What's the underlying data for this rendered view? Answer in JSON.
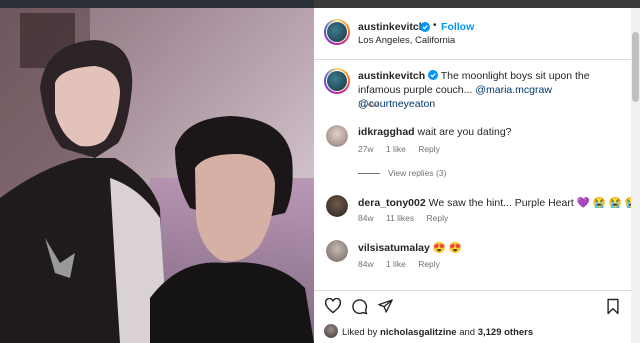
{
  "post": {
    "author": "austinkevitch",
    "follow_label": "Follow",
    "location": "Los Angeles, California",
    "caption_text": "The moonlight boys sit upon the infamous purple couch... ",
    "mentions": [
      "@maria.mcgraw",
      "@courtneyeaton"
    ],
    "age": "314w"
  },
  "comments": [
    {
      "user": "idkragghad",
      "text": "wait are you dating?",
      "age": "27w",
      "likes": "1 like",
      "reply": "Reply",
      "view_replies": "View replies (3)"
    },
    {
      "user": "dera_tony002",
      "text": "We saw the hint... Purple Heart 💜 😭 😭 😭 😭",
      "age": "84w",
      "likes": "11 likes",
      "reply": "Reply"
    },
    {
      "user": "vilsisatumalay",
      "text": "😍 😍",
      "age": "84w",
      "likes": "1 like",
      "reply": "Reply"
    }
  ],
  "likes": {
    "prefix": "Liked by ",
    "user": "nicholasgalitzine",
    "suffix": " and ",
    "others": "3,129 others"
  },
  "icons": [
    "heart-icon",
    "comment-icon",
    "share-icon",
    "bookmark-icon",
    "verified-badge-icon"
  ],
  "colors": {
    "link_blue": "#0095f6",
    "verified_blue": "#0095f6",
    "mention": "#00376b",
    "muted": "#737373"
  }
}
